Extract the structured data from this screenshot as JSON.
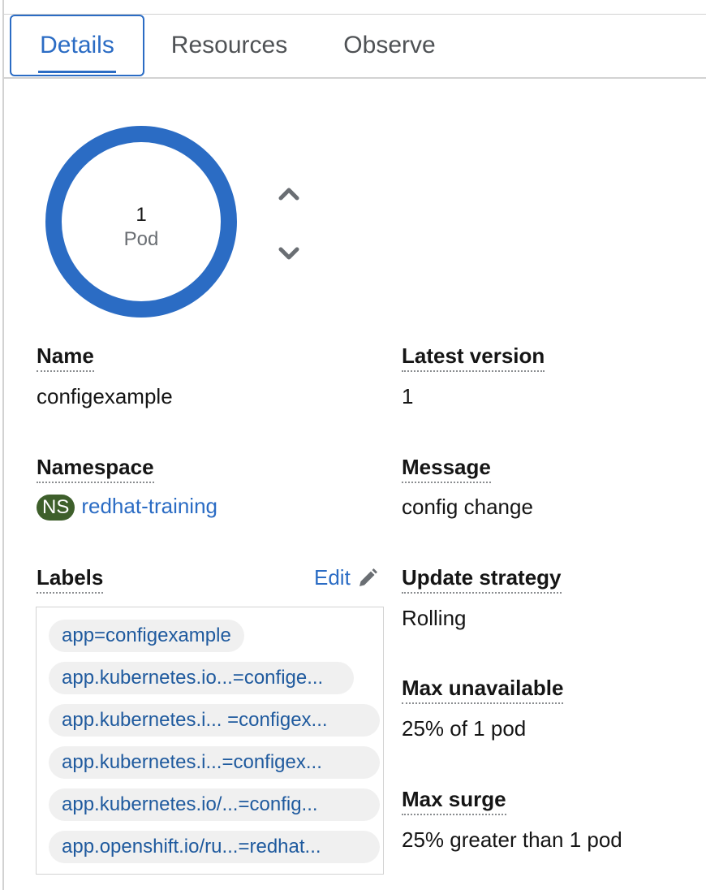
{
  "tabs": [
    {
      "label": "Details",
      "active": true
    },
    {
      "label": "Resources",
      "active": false
    },
    {
      "label": "Observe",
      "active": false
    }
  ],
  "pod_ring": {
    "count": "1",
    "unit": "Pod",
    "ring_color": "#2b6cc4"
  },
  "scale_controls": {
    "up_icon": "chevron-up-icon",
    "down_icon": "chevron-down-icon"
  },
  "details": {
    "name": {
      "label": "Name",
      "value": "configexample"
    },
    "namespace": {
      "label": "Namespace",
      "badge": "NS",
      "value": "redhat-training"
    },
    "labels": {
      "label": "Labels",
      "edit_label": "Edit",
      "items": [
        "app=configexample",
        "app.kubernetes.io...=confige...",
        "app.kubernetes.i... =configex...",
        "app.kubernetes.i...=configex...",
        "app.kubernetes.io/...=config...",
        "app.openshift.io/ru...=redhat..."
      ]
    },
    "latest_version": {
      "label": "Latest version",
      "value": "1"
    },
    "message": {
      "label": "Message",
      "value": "config change"
    },
    "update_strategy": {
      "label": "Update strategy",
      "value": "Rolling"
    },
    "max_unavailable": {
      "label": "Max unavailable",
      "value": "25% of 1 pod"
    },
    "max_surge": {
      "label": "Max surge",
      "value": "25% greater than 1 pod"
    }
  },
  "colors": {
    "accent": "#2b6cc4",
    "ns_badge": "#3e5f2b",
    "chip_bg": "#f0f0f0"
  }
}
